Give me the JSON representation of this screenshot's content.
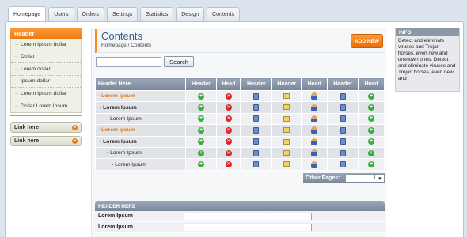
{
  "tabs": [
    "Homepage",
    "Users",
    "Orders",
    "Settings",
    "Statistics",
    "Design",
    "Contents"
  ],
  "sidebar": {
    "header": "Header",
    "items": [
      "Lorem Ipsum dollar",
      "Dollar",
      "Lorem dollar",
      "Ipsum dollar",
      "Lorem Ipsum dollar",
      "Dollar Lorem Ipsum"
    ],
    "links": [
      "Link here",
      "Link here"
    ]
  },
  "main": {
    "title": "Contents",
    "breadcrumb": "Homepage / Contents",
    "add_button": "ADD NEW",
    "search_button": "Search",
    "search_value": ""
  },
  "grid": {
    "columns": [
      "Header Here",
      "Header",
      "Head",
      "Header",
      "Header",
      "Head",
      "Header",
      "Head"
    ],
    "rows": [
      {
        "name": "- Lorem Ipsum",
        "level": 0
      },
      {
        "name": "- Lorem Ipsum",
        "level": 1
      },
      {
        "name": "- Lorem Ipsum",
        "level": 2
      },
      {
        "name": "- Lorem Ipsum",
        "level": 0
      },
      {
        "name": "- Lorem Ipsum",
        "level": 1
      },
      {
        "name": "- Lorem Ipsum",
        "level": 2
      },
      {
        "name": "- Lorem Ipsum",
        "level": 3
      }
    ],
    "row_icons": [
      "plus-icon",
      "delete-icon",
      "document-icon",
      "note-icon",
      "user-icon",
      "document-icon",
      "plus-icon"
    ]
  },
  "pager": {
    "label": "Other Pages:",
    "value": "1"
  },
  "form": {
    "header": "HEADER HERE",
    "rows": [
      "Lorem Ipsum",
      "Lorem Ipsum"
    ]
  },
  "info": {
    "header": "INFO",
    "text": "Detect and eliminate viruses and Trojan horses, even new and unknown ones. Detect and eliminate viruses and Trojan horses, even new and"
  },
  "colors": {
    "accent": "#f07a10",
    "header_gray": "#7a879b",
    "title_blue": "#3a5a8c"
  }
}
